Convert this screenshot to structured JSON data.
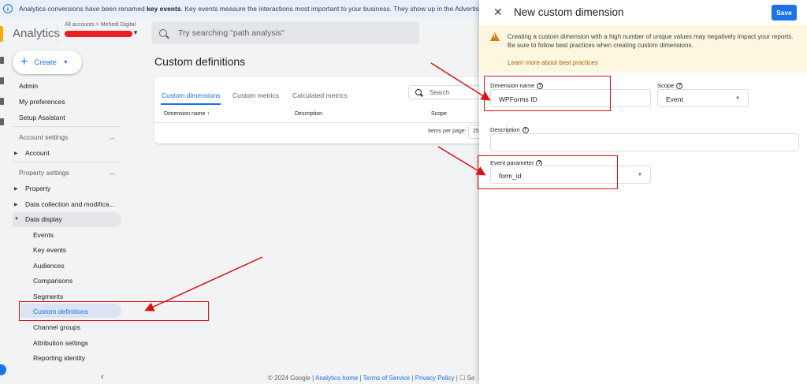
{
  "banner": {
    "pre": "Analytics conversions have been renamed ",
    "bold": "key events",
    "post": ". Key events measure the interactions most important to your business. They show up in the Advertising, Reports, and"
  },
  "header": {
    "app_name": "Analytics",
    "account_path": "All accounts > Mehedi Digital",
    "search_placeholder": "Try searching \"path analysis\""
  },
  "sidebar": {
    "create_label": "Create",
    "top_items": [
      "Admin",
      "My preferences",
      "Setup Assistant"
    ],
    "account_settings": "Account settings",
    "account": "Account",
    "property_settings": "Property settings",
    "property": "Property",
    "data_collection": "Data collection and modifica...",
    "data_display": "Data display",
    "sub_items": [
      "Events",
      "Key events",
      "Audiences",
      "Comparisons",
      "Segments",
      "Custom definitions",
      "Channel groups",
      "Attribution settings",
      "Reporting identity"
    ],
    "collapse_icon": "chevron-left-icon"
  },
  "main": {
    "title": "Custom definitions",
    "tabs": [
      "Custom dimensions",
      "Custom metrics",
      "Calculated metrics"
    ],
    "search_placeholder": "Search",
    "columns": [
      "Dimension name ↑",
      "Description",
      "Scope"
    ],
    "items_per_page_label": "Items per page:",
    "items_per_page_value": "25"
  },
  "footer": {
    "copyright": "© 2024 Google | ",
    "home": "Analytics home",
    "sep1": " | ",
    "tos": "Terms of Service",
    "sep2": " | ",
    "privacy": "Privacy Policy",
    "tail": " | ☐ Se"
  },
  "drawer": {
    "title": "New custom dimension",
    "save_label": "Save",
    "warning": "Creating a custom dimension with a high number of unique values may negatively impact your reports. Be sure to follow best practices when creating custom dimensions.",
    "learn_more": "Learn more about best practices",
    "dimension_name_label": "Dimension name",
    "dimension_name_value": "WPForms ID",
    "scope_label": "Scope",
    "scope_value": "Event",
    "description_label": "Description",
    "description_value": "",
    "event_parameter_label": "Event parameter",
    "event_parameter_value": "form_id"
  },
  "colors": {
    "accent": "#1a73e8",
    "warning_bg": "#fef7e0",
    "annotation": "#e01010"
  }
}
